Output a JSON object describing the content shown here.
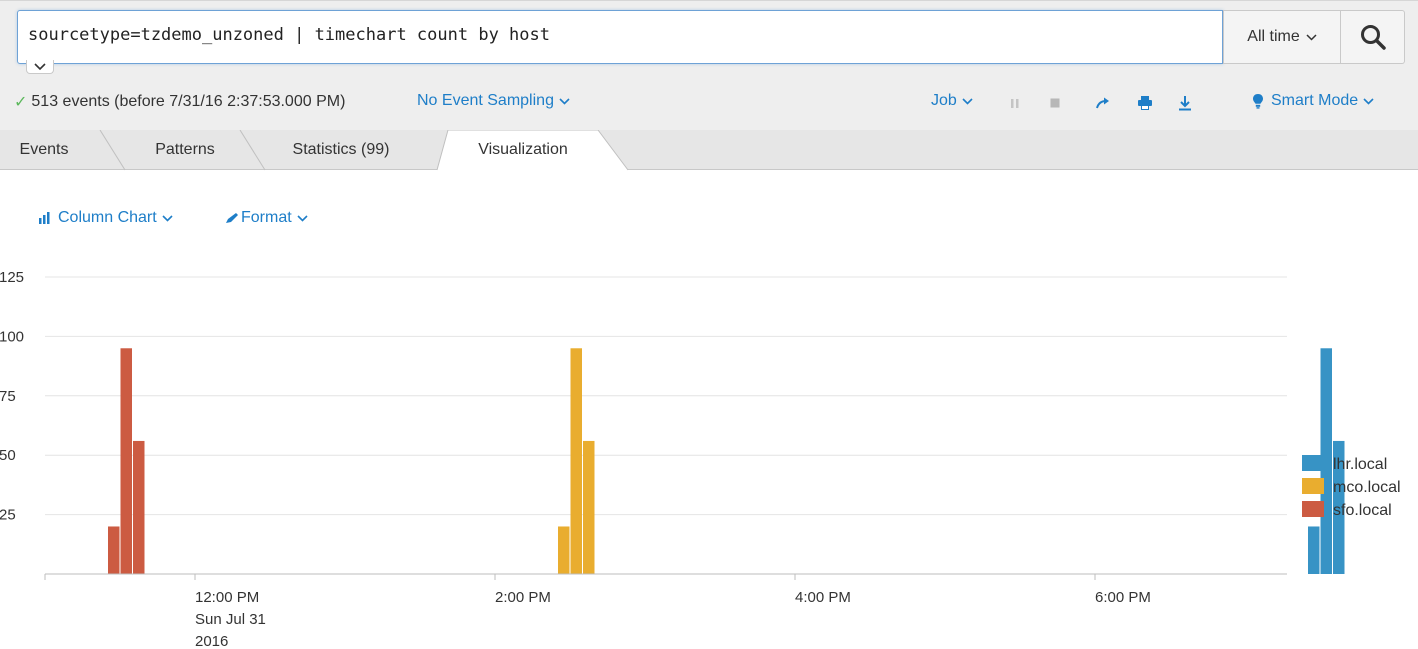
{
  "search": {
    "query": "sourcetype=tzdemo_unzoned | timechart count by host",
    "time_range": "All time"
  },
  "job": {
    "status": "513 events (before 7/31/16 2:37:53.000 PM)",
    "sampling": "No Event Sampling",
    "job_label": "Job",
    "mode": "Smart Mode"
  },
  "tabs": [
    {
      "label": "Events"
    },
    {
      "label": "Patterns"
    },
    {
      "label": "Statistics (99)"
    },
    {
      "label": "Visualization"
    }
  ],
  "viz_toolbar": {
    "chart_type_label": "Column Chart",
    "format_label": "Format"
  },
  "colors": {
    "accent": "#1e7ec8",
    "lhr": "#3793c5",
    "mco": "#e9ad2f",
    "sfo": "#cc5b42",
    "success": "#5cb85c"
  },
  "chart_data": {
    "type": "bar",
    "stacked": false,
    "y_tick_labels": [
      "25",
      "50",
      "75",
      "100",
      "125"
    ],
    "ylim": [
      0,
      125
    ],
    "x_ticks": [
      {
        "time": "12:00 PM",
        "date_line1": "Sun Jul 31",
        "date_line2": "2016"
      },
      {
        "time": "2:00 PM"
      },
      {
        "time": "4:00 PM"
      },
      {
        "time": "6:00 PM"
      }
    ],
    "grid": true,
    "legend_position": "right",
    "series": [
      {
        "name": "lhr.local",
        "color": "#3793c5",
        "points": [
          {
            "time": "19:25",
            "value": 20
          },
          {
            "time": "19:30",
            "value": 95
          },
          {
            "time": "19:35",
            "value": 56
          }
        ]
      },
      {
        "name": "mco.local",
        "color": "#e9ad2f",
        "points": [
          {
            "time": "14:25",
            "value": 20
          },
          {
            "time": "14:30",
            "value": 95
          },
          {
            "time": "14:35",
            "value": 56
          }
        ]
      },
      {
        "name": "sfo.local",
        "color": "#cc5b42",
        "points": [
          {
            "time": "11:25",
            "value": 20
          },
          {
            "time": "11:30",
            "value": 95
          },
          {
            "time": "11:35",
            "value": 56
          }
        ]
      }
    ]
  }
}
